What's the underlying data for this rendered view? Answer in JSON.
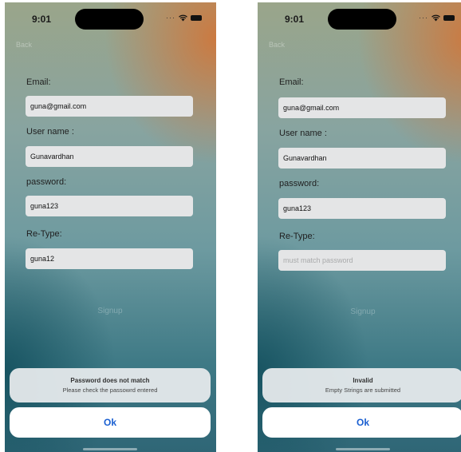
{
  "colors": {
    "ok_button_text": "#1a5fd1",
    "input_background": "#e4e5e6",
    "alert_background": "#e8ecee"
  },
  "screens": [
    {
      "status_bar": {
        "time": "9:01",
        "icons": [
          "signal-dots-icon",
          "wifi-icon",
          "battery-icon"
        ]
      },
      "back_label": "Back",
      "form": {
        "email_label": "Email:",
        "email_value": "guna@gmail.com",
        "username_label": "User name :",
        "username_value": "Gunavardhan",
        "password_label": "password:",
        "password_value": "guna123",
        "retype_label": "Re-Type:",
        "retype_value": "guna12",
        "retype_placeholder": "must match password"
      },
      "signup_label": "Signup",
      "alert": {
        "title": "Password does not match",
        "message": "Please check the passowrd entered",
        "ok_label": "Ok"
      }
    },
    {
      "status_bar": {
        "time": "9:01",
        "icons": [
          "signal-dots-icon",
          "wifi-icon",
          "battery-icon"
        ]
      },
      "back_label": "Back",
      "form": {
        "email_label": "Email:",
        "email_value": "guna@gmail.com",
        "username_label": "User name :",
        "username_value": "Gunavardhan",
        "password_label": "password:",
        "password_value": "guna123",
        "retype_label": "Re-Type:",
        "retype_value": "",
        "retype_placeholder": "must match password"
      },
      "signup_label": "Signup",
      "alert": {
        "title": "Invalid",
        "message": "Empty Strings are submitted",
        "ok_label": "Ok"
      }
    }
  ]
}
